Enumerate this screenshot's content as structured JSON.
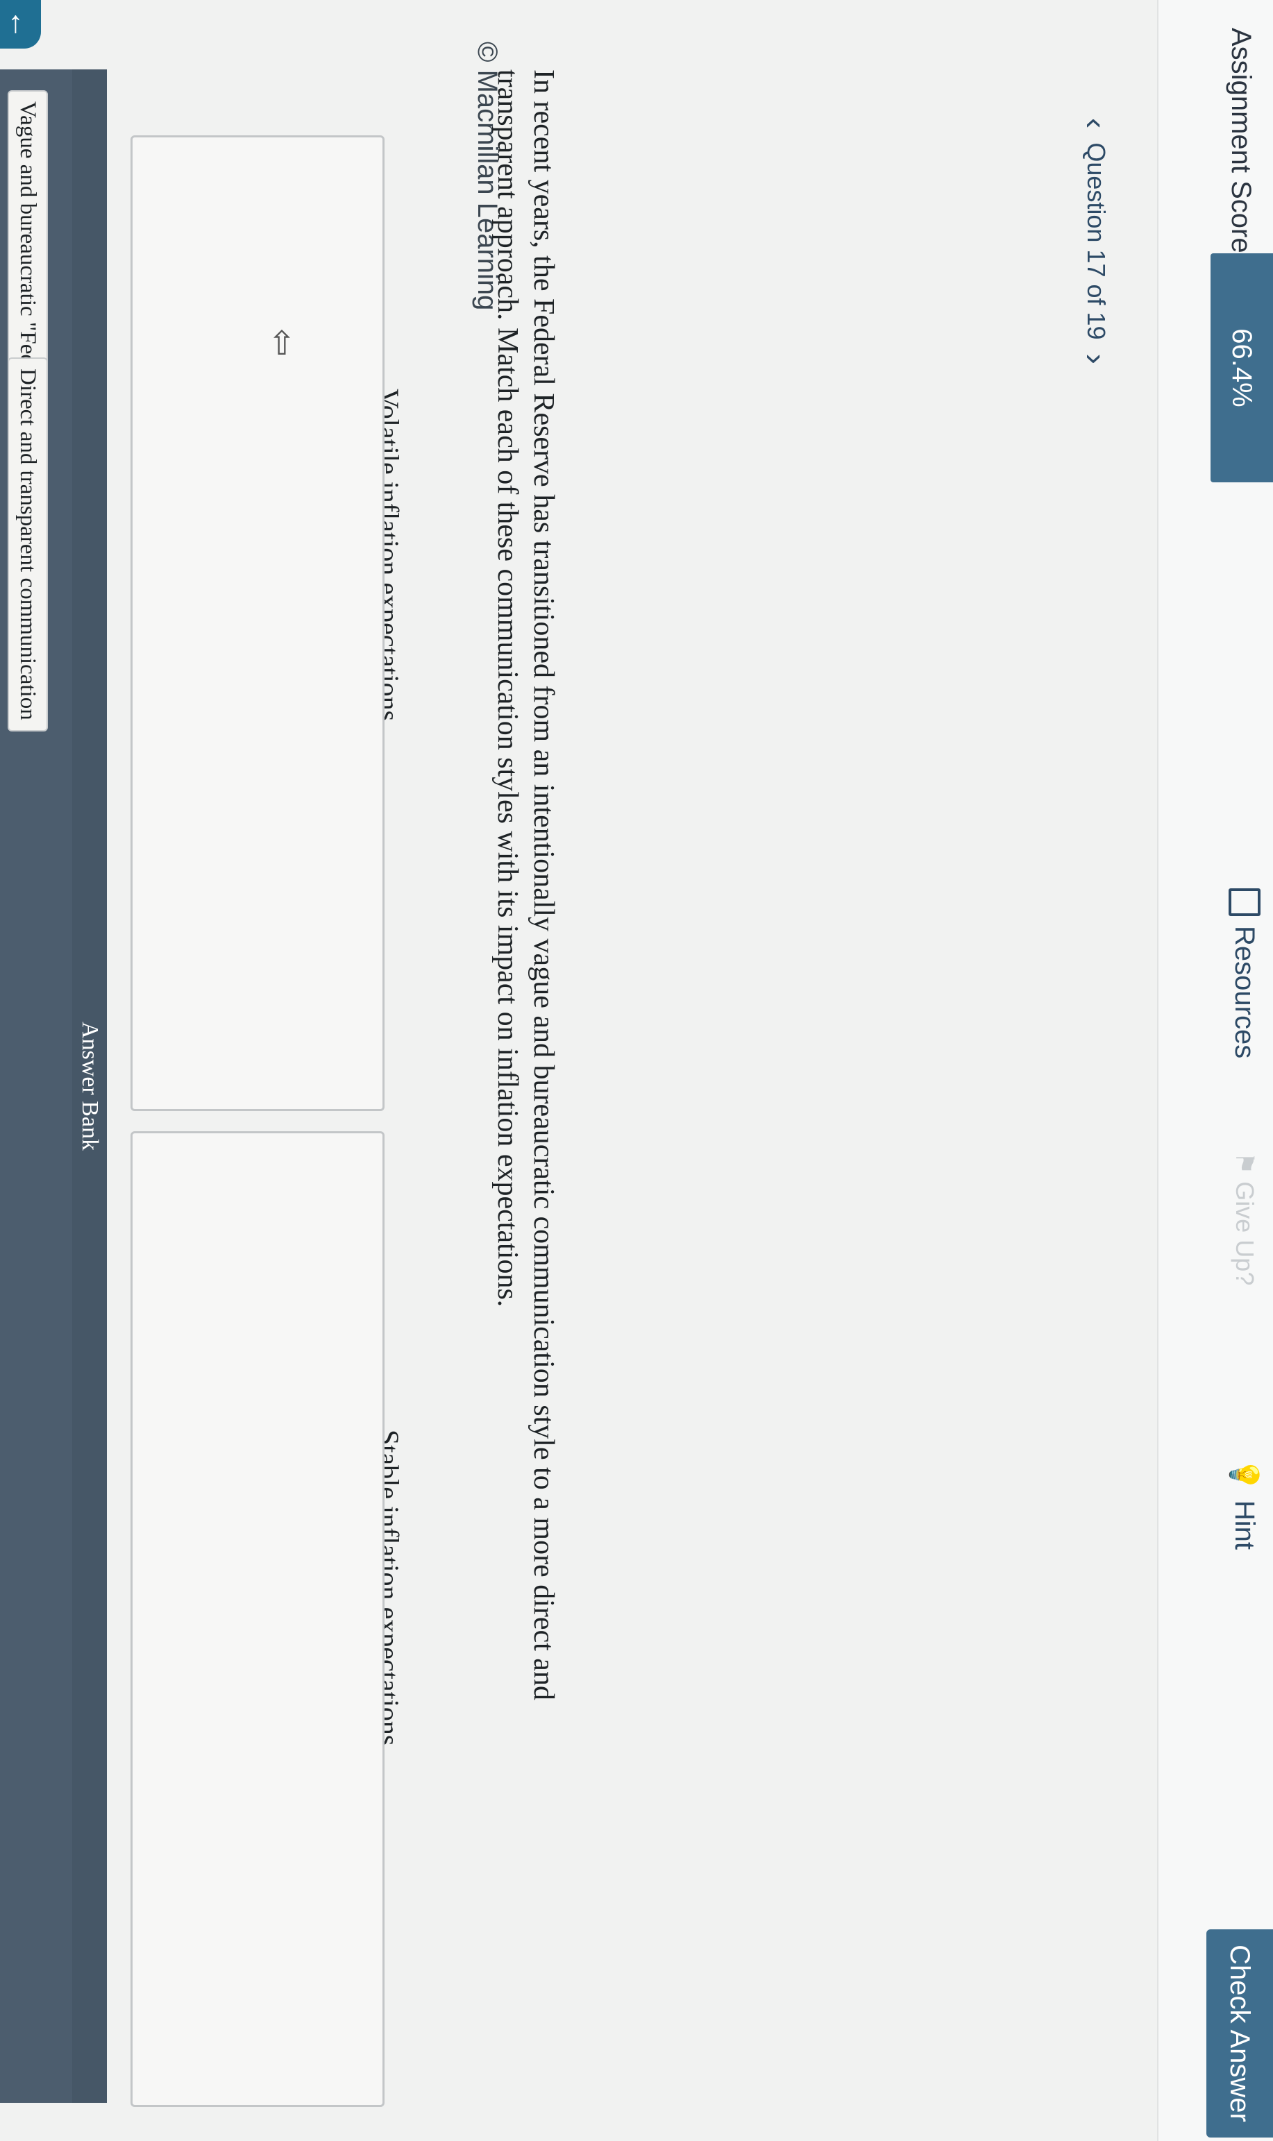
{
  "header": {
    "score_label": "Assignment Score:",
    "score_value": "66.4%",
    "resources_label": "Resources",
    "giveup_label": "Give Up?",
    "hint_label": "Hint",
    "check_answer_label": "Check Answer"
  },
  "nav": {
    "question_label": "Question 17 of 19"
  },
  "copyright": "© Macmillan Learning",
  "question": {
    "text": "In recent years, the Federal Reserve has transitioned from an intentionally vague and bureaucratic communication style to a more direct and transparent approach. Match each of these communication styles with its impact on inflation expectations."
  },
  "targets": [
    {
      "label": "Volatile inflation expectations"
    },
    {
      "label": "Stable inflation expectations"
    }
  ],
  "answer_bank": {
    "title": "Answer Bank",
    "items": [
      {
        "label": "Vague and bureaucratic \"Fed-speak\""
      },
      {
        "label": "Direct and transparent communication"
      }
    ]
  },
  "colors": {
    "accent": "#3f6e8e",
    "answer_bank_bg": "#4c5d6e"
  }
}
